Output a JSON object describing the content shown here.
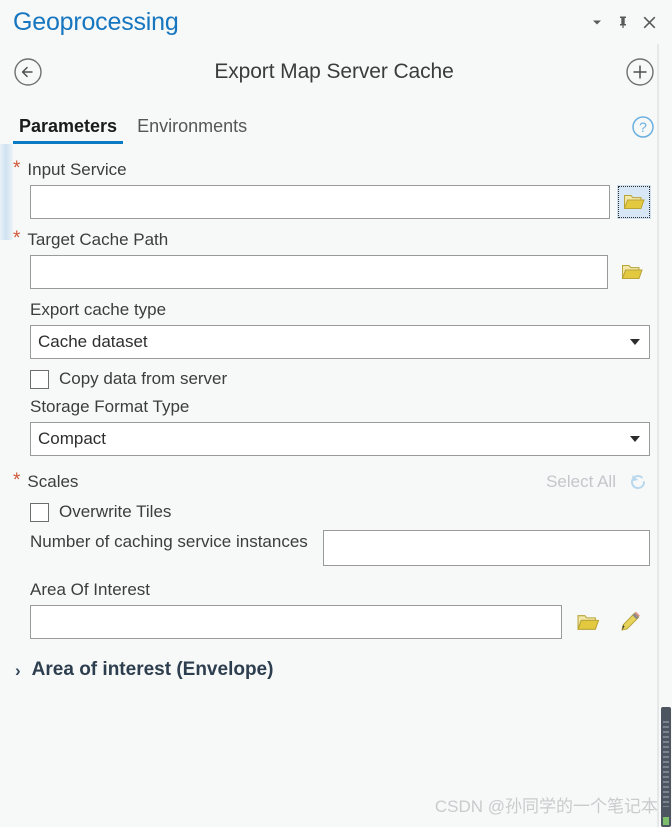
{
  "window": {
    "title": "Geoprocessing",
    "controls": [
      {
        "name": "menu-dropdown",
        "icon": "chevron-down-icon"
      },
      {
        "name": "pin",
        "icon": "pin-icon"
      },
      {
        "name": "close",
        "icon": "close-icon"
      }
    ]
  },
  "tool_header": {
    "back_icon": "back-arrow-circle-icon",
    "title": "Export Map Server Cache",
    "add_icon": "plus-circle-icon"
  },
  "tabs": {
    "items": [
      {
        "label": "Parameters",
        "active": true
      },
      {
        "label": "Environments",
        "active": false
      }
    ],
    "help_icon": "help-circle-icon"
  },
  "parameters": {
    "input_service": {
      "label": "Input Service",
      "required_marker": "*",
      "value": "",
      "browse_icon": "folder-open-icon",
      "browse_focused": true
    },
    "target_cache_path": {
      "label": "Target Cache Path",
      "required_marker": "*",
      "value": "",
      "browse_icon": "folder-open-icon"
    },
    "export_cache_type": {
      "label": "Export cache type",
      "value": "Cache dataset",
      "caret_icon": "chevron-down-icon"
    },
    "copy_data_from_server": {
      "label": "Copy data from server",
      "checked": false
    },
    "storage_format_type": {
      "label": "Storage Format Type",
      "value": "Compact",
      "caret_icon": "chevron-down-icon"
    },
    "scales": {
      "label": "Scales",
      "required_marker": "*",
      "select_all_label": "Select All",
      "select_all_enabled": false,
      "reset_icon": "reset-circular-arrow-icon"
    },
    "overwrite_tiles": {
      "label": "Overwrite Tiles",
      "checked": false
    },
    "num_caching_instances": {
      "label": "Number of caching service instances",
      "value": ""
    },
    "area_of_interest": {
      "label": "Area Of Interest",
      "value": "",
      "browse_icon": "folder-open-icon",
      "draw_icon": "pencil-icon"
    },
    "envelope_section": {
      "chevron": "›",
      "title": "Area of interest (Envelope)",
      "expanded": false
    }
  },
  "watermark": {
    "text": "CSDN @孙同学的一个笔记本"
  },
  "colors": {
    "accent_blue": "#1676c0",
    "tab_underline": "#0d7ac4",
    "required_asterisk": "#d0573a",
    "folder_yellow": "#e2c93f",
    "pane_background": "#f7f8f8"
  }
}
